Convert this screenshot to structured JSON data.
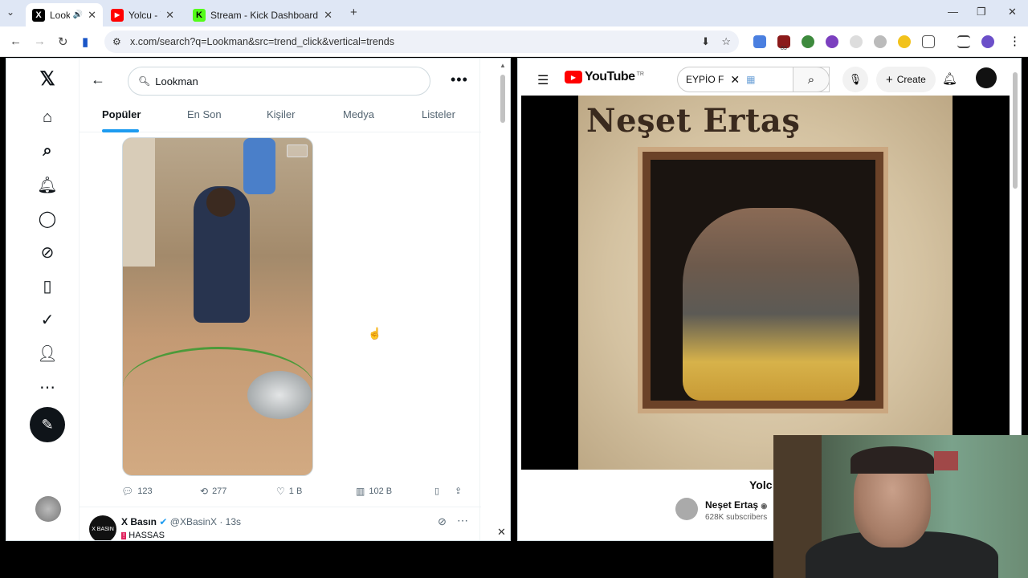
{
  "browser": {
    "tabs": [
      {
        "label": "Look",
        "favicon": "X",
        "color": "#000000"
      },
      {
        "label": "Yolcu - Yo",
        "favicon": "▶",
        "color": "#ff0000"
      },
      {
        "label": "Stream - Kick Dashboard",
        "favicon": "K",
        "color": "#53fc18"
      }
    ],
    "new_tab": "+",
    "url": "x.com/search?q=Lookman&src=trend_click&vertical=trends",
    "ext_badge": "83"
  },
  "x": {
    "search_value": "Lookman",
    "tabs": [
      "Popüler",
      "En Son",
      "Kişiler",
      "Medya",
      "Listeler"
    ],
    "stats": {
      "replies": "123",
      "reposts": "277",
      "likes": "1 B",
      "views": "102 B"
    },
    "next_tweet": {
      "name": "X Basın",
      "handle": "@XBasinX",
      "time": "· 13s",
      "text": "HASSAS",
      "avatar_text": "X BASIN"
    }
  },
  "youtube": {
    "logo": "YouTube",
    "country": "TR",
    "search_value": "EYPİO F",
    "create": "Create",
    "album_title": "Neşet Ertaş",
    "video_title": "Yolc",
    "channel": "Neşet Ertaş",
    "subscribers": "628K subscribers"
  }
}
